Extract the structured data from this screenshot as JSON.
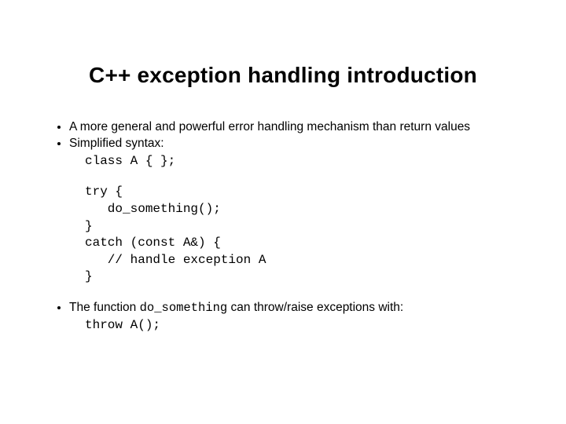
{
  "title": "C++ exception handling introduction",
  "bullets": {
    "b1": "A more general and powerful error handling mechanism than return values",
    "b2": "Simplified syntax:",
    "b3_pre": "The function ",
    "b3_code": "do_something",
    "b3_post": " can throw/raise exceptions with:"
  },
  "code": {
    "class_decl": "class A { };",
    "try_block": "try {\n   do_something();\n}\ncatch (const A&) {\n   // handle exception A\n}",
    "throw_line": "throw A();"
  }
}
